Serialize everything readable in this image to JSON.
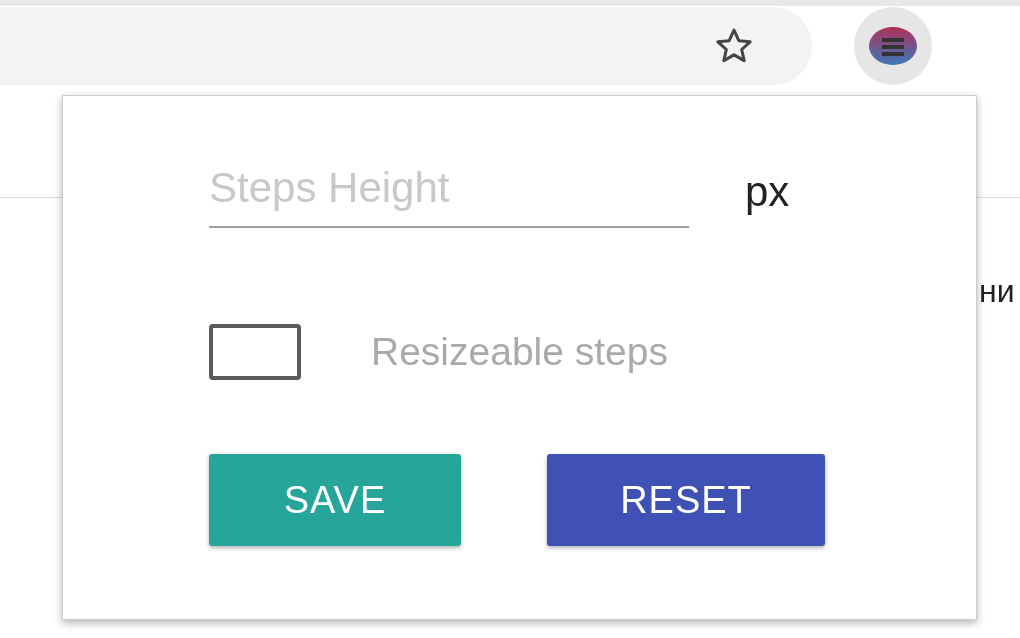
{
  "toolbar": {
    "bookmark_starred": false
  },
  "page": {
    "text_fragment": "ни"
  },
  "popup": {
    "height_field": {
      "placeholder": "Steps Height",
      "unit": "px"
    },
    "resizeable_checkbox": {
      "label": "Resizeable steps",
      "checked": false
    },
    "buttons": [
      {
        "label": "SAVE",
        "kind": "primary"
      },
      {
        "label": "RESET",
        "kind": "secondary"
      }
    ]
  }
}
